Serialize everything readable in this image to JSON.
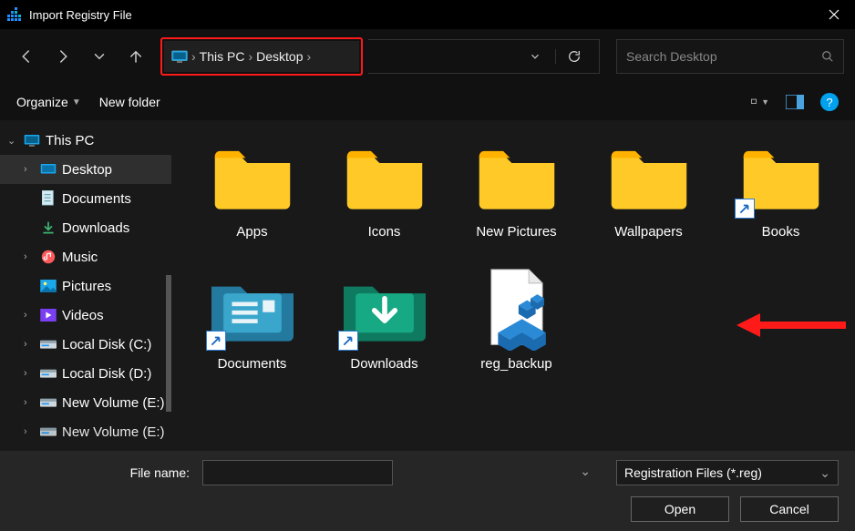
{
  "window": {
    "title": "Import Registry File"
  },
  "breadcrumb": {
    "seg1": "This PC",
    "seg2": "Desktop"
  },
  "search": {
    "placeholder": "Search Desktop"
  },
  "toolbar": {
    "organize": "Organize",
    "newfolder": "New folder"
  },
  "tree": {
    "root": "This PC",
    "items": [
      "Desktop",
      "Documents",
      "Downloads",
      "Music",
      "Pictures",
      "Videos",
      "Local Disk (C:)",
      "Local Disk (D:)",
      "New Volume (E:)",
      "New Volume (E:)"
    ]
  },
  "files": [
    {
      "label": "Apps"
    },
    {
      "label": "Icons"
    },
    {
      "label": "New Pictures"
    },
    {
      "label": "Wallpapers"
    },
    {
      "label": "Books"
    },
    {
      "label": "Documents"
    },
    {
      "label": "Downloads"
    },
    {
      "label": "reg_backup"
    }
  ],
  "bottom": {
    "filename_label": "File name:",
    "filetype": "Registration Files (*.reg)",
    "open": "Open",
    "cancel": "Cancel"
  }
}
